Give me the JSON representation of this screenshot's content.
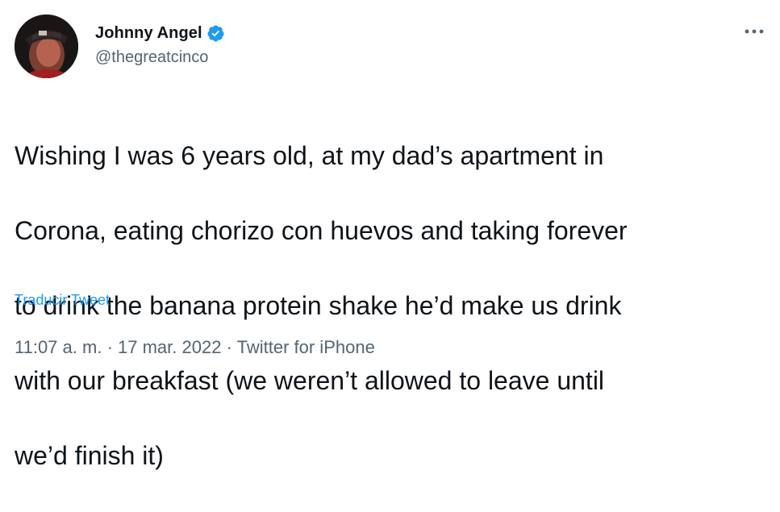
{
  "author": {
    "display_name": "Johnny Angel",
    "handle": "@thegreatcinco",
    "verified": true,
    "avatar_icon": "profile-photo"
  },
  "tweet": {
    "lines": [
      "Wishing I was 6 years old, at my dad’s apartment in",
      "Corona, eating chorizo con huevos and taking forever",
      "to drink the banana protein shake he’d make us drink",
      "with our breakfast (we weren’t allowed to leave until",
      "we’d finish it)"
    ],
    "translate_label": "Traducir Tweet"
  },
  "meta": {
    "time": "11:07 a. m.",
    "separator": "·",
    "date": "17 mar. 2022",
    "source": "Twitter for iPhone"
  },
  "more_label": "•••",
  "colors": {
    "text": "#0f1419",
    "secondary": "#536471",
    "accent": "#1d9bf0"
  }
}
